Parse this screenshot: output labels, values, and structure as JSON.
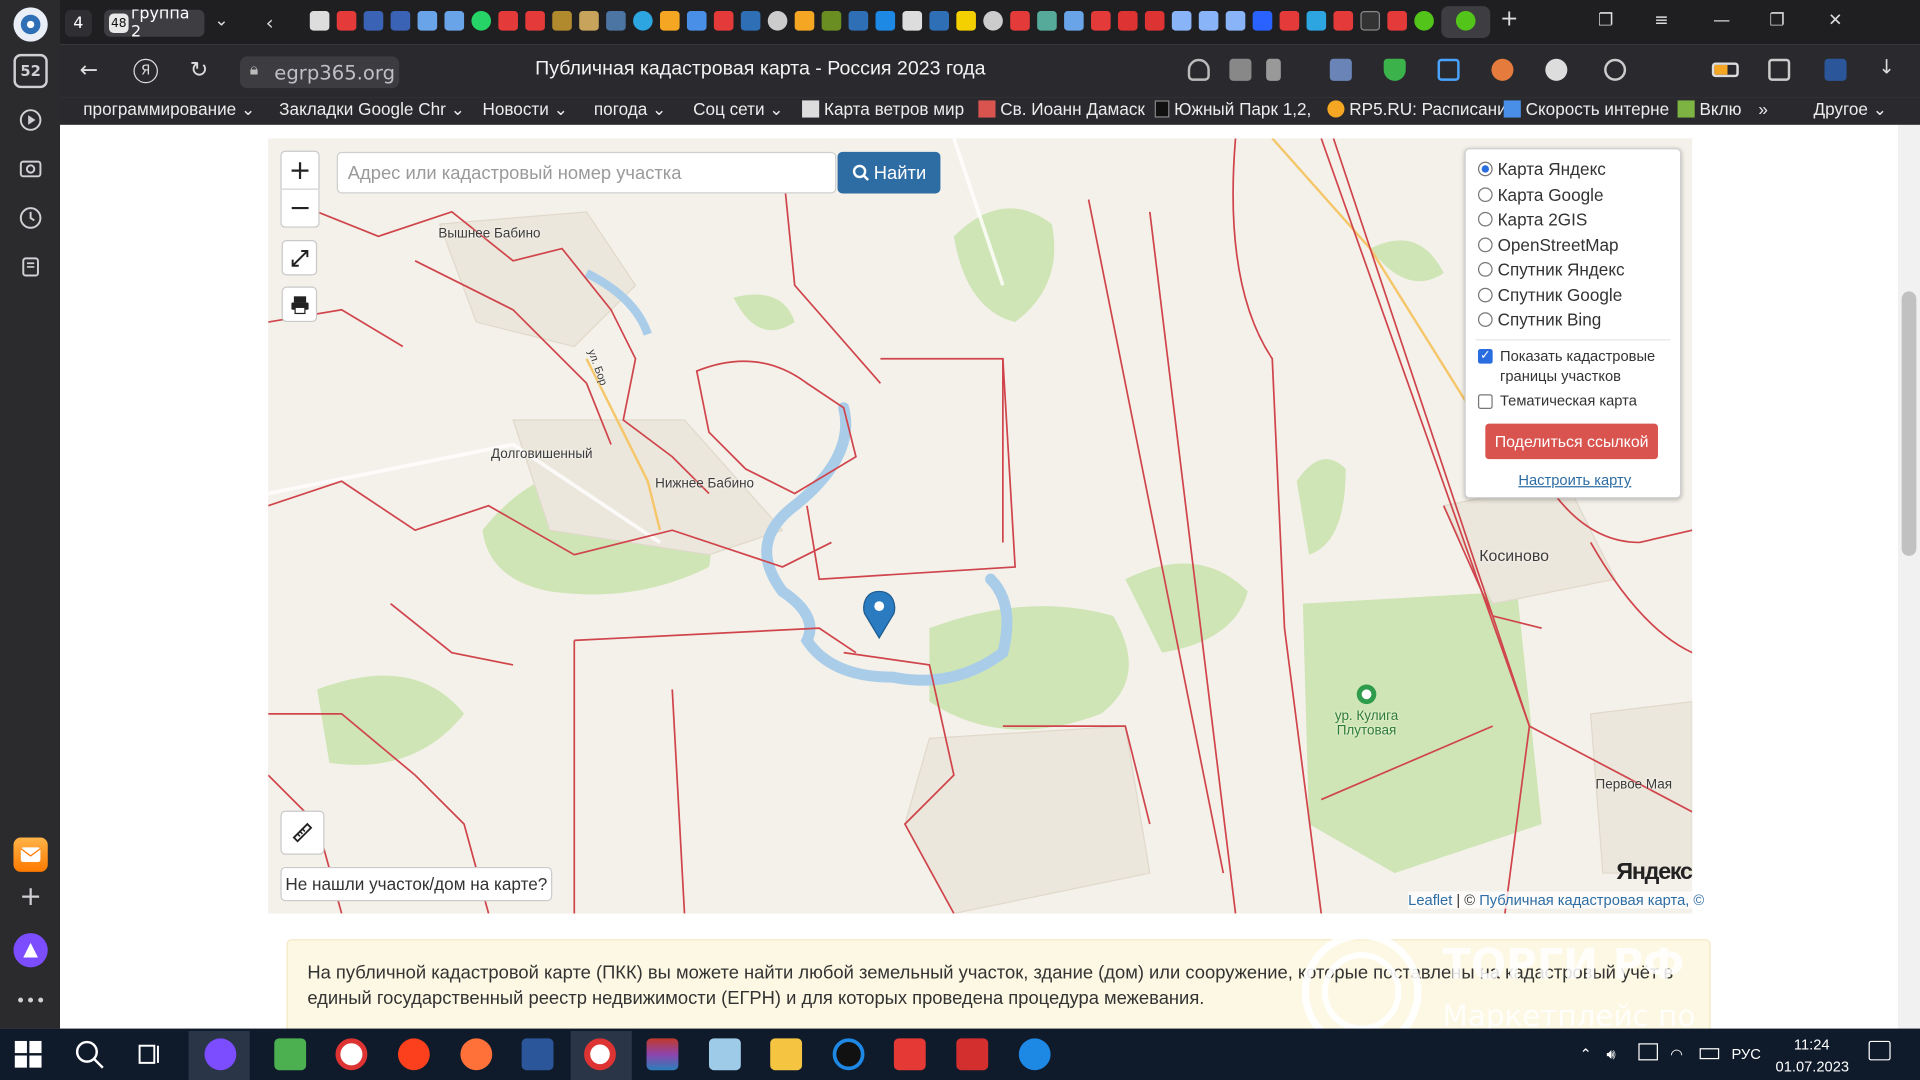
{
  "browser": {
    "tab_count": "4",
    "tab_group_count": "48",
    "tab_group_label": "группа 2",
    "sidebar_badge": "52",
    "url": "egrp365.org",
    "page_title": "Публичная кадастровая карта - Россия 2023 года"
  },
  "bookmarks": [
    "программирование",
    "Закладки Google Chr",
    "Новости",
    "погода",
    "Соц сети",
    "Карта ветров мир",
    "Св. Иоанн Дамаск",
    "Южный Парк 1,2,",
    "RP5.RU: Расписани",
    "Скорость интерне",
    "Вклю",
    "Другое"
  ],
  "search": {
    "placeholder": "Адрес или кадастровый номер участка",
    "button": "Найти"
  },
  "layers": {
    "options": [
      "Карта Яндекс",
      "Карта Google",
      "Карта 2GIS",
      "OpenStreetMap",
      "Спутник Яндекс",
      "Спутник Google",
      "Спутник Bing"
    ],
    "selected": "Карта Яндекс",
    "show_boundaries": "Показать кадастровые границы участков",
    "show_boundaries_checked": true,
    "thematic": "Тематическая карта",
    "thematic_checked": false,
    "share_button": "Поделиться ссылкой",
    "setup_link": "Настроить карту"
  },
  "map": {
    "labels": [
      "Вышнее Бабино",
      "Долговишенный",
      "Нижнее Бабино",
      "Косиново",
      "ур. Кулига Плутовая",
      "Первое Мая",
      "ул. Бор"
    ],
    "not_found_button": "Не нашли участок/дом на карте?",
    "attribution_leaflet": "Leaflet",
    "attribution_sep": " | © ",
    "attribution_pkk": "Публичная кадастровая карта, ©",
    "yandex_logo": "Яндекс"
  },
  "info_text": "На публичной кадастровой карте (ПКК) вы можете найти любой земельный участок, здание (дом) или сооружение, которые поставлены на кадастровый учёт в единый государственный реестр недвижимости (ЕГРН) и для которых проведена процедура межевания.",
  "watermark": {
    "title": "ТОРГИ РФ",
    "subtitle": "Маркетплейс по"
  },
  "tray": {
    "lang": "РУС",
    "time": "11:24",
    "date": "01.07.2023"
  },
  "colors": {
    "accent": "#2e6da4",
    "share": "#d9534f",
    "boundary": "#d0454c"
  }
}
